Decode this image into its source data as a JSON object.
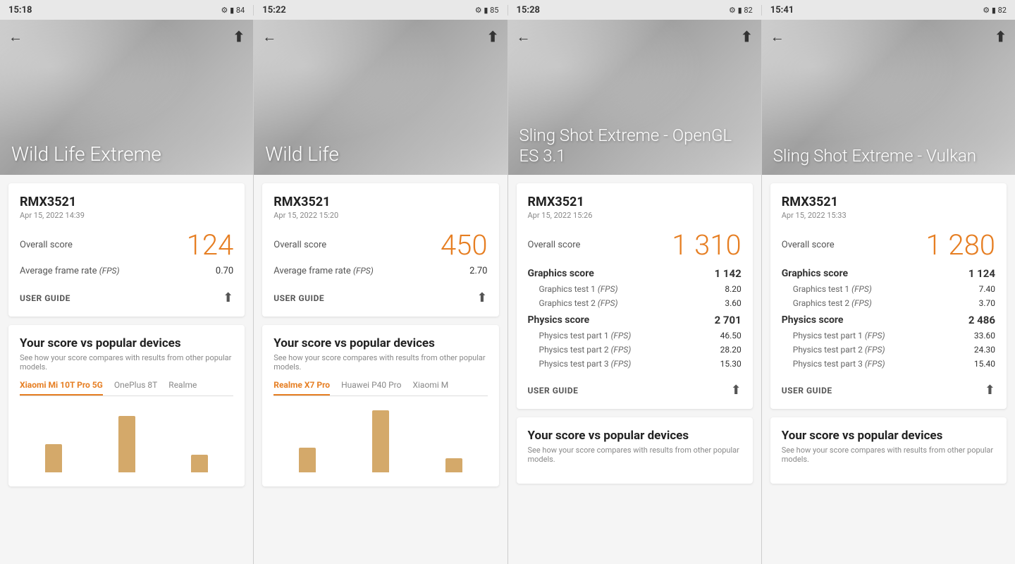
{
  "statusBar": [
    {
      "time": "15:18",
      "icons": "⚙ M 84"
    },
    {
      "time": "15:22",
      "icons": "⚙ M 85"
    },
    {
      "time": "15:28",
      "icons": "⚙ M 82"
    },
    {
      "time": "15:41",
      "icons": "⚙ M 82"
    }
  ],
  "panels": [
    {
      "id": "panel1",
      "bannerTitle": "Wild Life Extreme",
      "device": "RMX3521",
      "date": "Apr 15, 2022 14:39",
      "overallScore": "124",
      "rows": [
        {
          "label": "Overall score",
          "value": "124",
          "type": "overall"
        },
        {
          "label": "Average frame rate (FPS)",
          "value": "0.70",
          "type": "normal"
        }
      ],
      "sections": [],
      "popularTitle": "Your score vs popular devices",
      "popularSubtitle": "See how your score compares with results from other popular models.",
      "popularTabs": [
        "Xiaomi Mi 10T Pro 5G",
        "OnePlus 8T",
        "Realme"
      ],
      "activeTab": 0,
      "bars": [
        40,
        85,
        30
      ]
    },
    {
      "id": "panel2",
      "bannerTitle": "Wild Life",
      "device": "RMX3521",
      "date": "Apr 15, 2022 15:20",
      "overallScore": "450",
      "rows": [
        {
          "label": "Overall score",
          "value": "450",
          "type": "overall"
        },
        {
          "label": "Average frame rate (FPS)",
          "value": "2.70",
          "type": "normal"
        }
      ],
      "sections": [],
      "popularTitle": "Your score vs popular devices",
      "popularSubtitle": "See how your score compares with results from other popular models.",
      "popularTabs": [
        "Realme X7 Pro",
        "Huawei P40 Pro",
        "Xiaomi M"
      ],
      "activeTab": 0,
      "bars": [
        30,
        90,
        20
      ]
    },
    {
      "id": "panel3",
      "bannerTitle": "Sling Shot Extreme - OpenGL ES 3.1",
      "device": "RMX3521",
      "date": "Apr 15, 2022 15:26",
      "overallScore": "1 310",
      "rows": [],
      "sections": [
        {
          "label": "Graphics score",
          "value": "1 142",
          "type": "section"
        },
        {
          "label": "Graphics test 1 (FPS)",
          "value": "8.20",
          "type": "sub"
        },
        {
          "label": "Graphics test 2 (FPS)",
          "value": "3.60",
          "type": "sub"
        },
        {
          "label": "Physics score",
          "value": "2 701",
          "type": "section"
        },
        {
          "label": "Physics test part 1 (FPS)",
          "value": "46.50",
          "type": "sub"
        },
        {
          "label": "Physics test part 2 (FPS)",
          "value": "28.20",
          "type": "sub"
        },
        {
          "label": "Physics test part 3 (FPS)",
          "value": "15.30",
          "type": "sub"
        }
      ],
      "popularTitle": "Your score vs popular devices",
      "popularSubtitle": "See how your score compares with results from other popular models.",
      "popularTabs": [],
      "bars": []
    },
    {
      "id": "panel4",
      "bannerTitle": "Sling Shot Extreme - Vulkan",
      "device": "RMX3521",
      "date": "Apr 15, 2022 15:33",
      "overallScore": "1 280",
      "rows": [],
      "sections": [
        {
          "label": "Graphics score",
          "value": "1 124",
          "type": "section"
        },
        {
          "label": "Graphics test 1 (FPS)",
          "value": "7.40",
          "type": "sub"
        },
        {
          "label": "Graphics test 2 (FPS)",
          "value": "3.70",
          "type": "sub"
        },
        {
          "label": "Physics score",
          "value": "2 486",
          "type": "section"
        },
        {
          "label": "Physics test part 1 (FPS)",
          "value": "33.60",
          "type": "sub"
        },
        {
          "label": "Physics test part 2 (FPS)",
          "value": "24.30",
          "type": "sub"
        },
        {
          "label": "Physics test part 3 (FPS)",
          "value": "15.40",
          "type": "sub"
        }
      ],
      "popularTitle": "Your score vs popular devices",
      "popularSubtitle": "See how your score compares with results from other popular models.",
      "popularTabs": [],
      "bars": []
    }
  ],
  "labels": {
    "userGuide": "USER GUIDE",
    "yourScoreTitle": "Your score vs popular devices",
    "yourScoreSubtitle": "See how your score compares with results from other popular models."
  }
}
